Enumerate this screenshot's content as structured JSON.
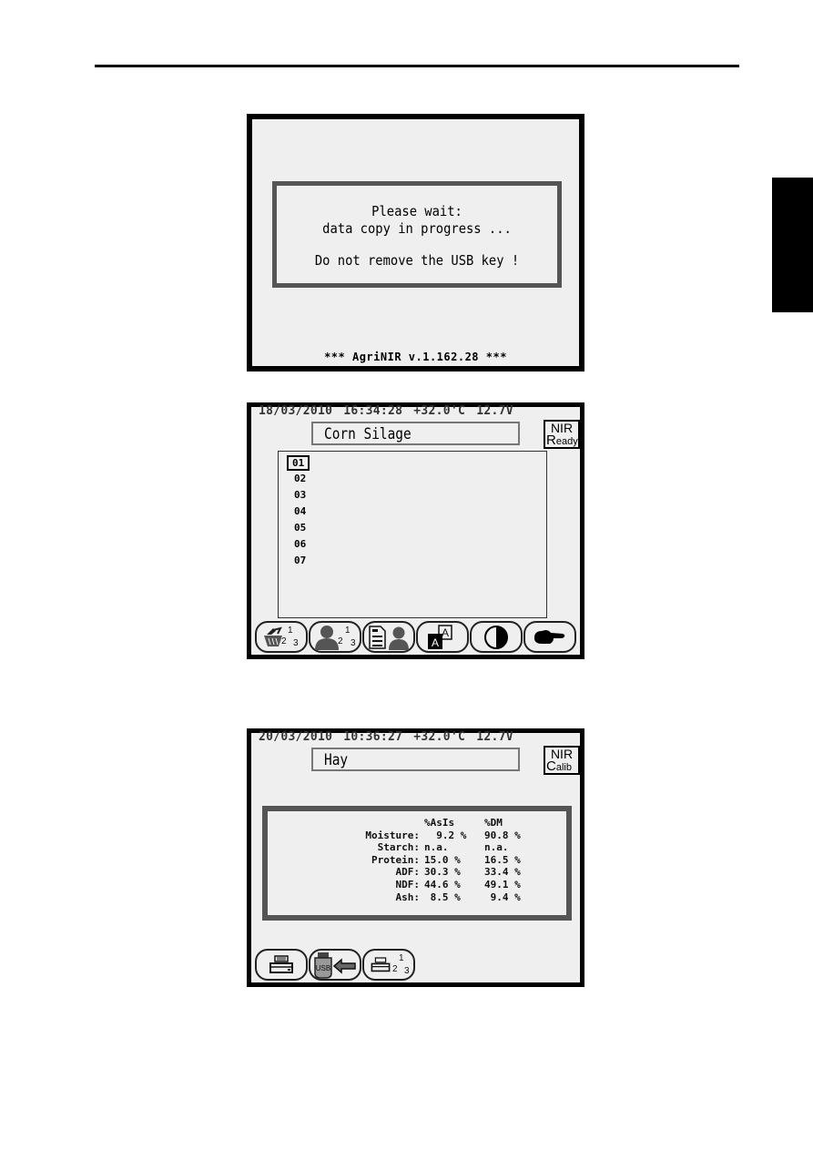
{
  "page": {
    "decorations": [
      "header-rule",
      "side-tab"
    ]
  },
  "screen1": {
    "dialog": {
      "line1": "Please wait:",
      "line2": "data copy in progress ...",
      "line3": "Do not remove the USB key !"
    },
    "footer": "*** AgriNIR v.1.162.28 ***"
  },
  "screen2": {
    "status": {
      "date": "18/03/2010",
      "time": "16:34:28",
      "temperature": "+32.0'C",
      "voltage": "12.7V"
    },
    "product_name": "Corn Silage",
    "nir_badge": {
      "top": "NIR",
      "bottom_initial": "R",
      "bottom_rest": "eady"
    },
    "samples": [
      "01",
      "02",
      "03",
      "04",
      "05",
      "06",
      "07"
    ],
    "selected_sample": "01",
    "toolbar": [
      {
        "icon": "analysis-repeat-icon",
        "numbers": "1 2 3"
      },
      {
        "icon": "operator-numbered-icon",
        "numbers": "1 2 3"
      },
      {
        "icon": "document-operator-icon"
      },
      {
        "icon": "font-size-icon",
        "glyph": "A"
      },
      {
        "icon": "contrast-icon"
      },
      {
        "icon": "pointing-hand-icon"
      }
    ]
  },
  "screen3": {
    "status": {
      "date": "20/03/2010",
      "time": "10:36:27",
      "temperature": "+32.0'C",
      "voltage": "12.7V"
    },
    "product_name": "Hay",
    "nir_badge": {
      "top": "NIR",
      "bottom_initial": "C",
      "bottom_rest": "alib"
    },
    "results": {
      "headers": {
        "label": "",
        "asis": "%AsIs",
        "dm": "%DM"
      },
      "rows": [
        {
          "label": "Moisture:",
          "asis": "  9.2 %",
          "dm": "90.8 %"
        },
        {
          "label": "Starch:",
          "asis": "n.a.",
          "dm": "n.a."
        },
        {
          "label": "Protein:",
          "asis": "15.0 %",
          "dm": "16.5 %"
        },
        {
          "label": "ADF:",
          "asis": "30.3 %",
          "dm": "33.4 %"
        },
        {
          "label": "NDF:",
          "asis": "44.6 %",
          "dm": "49.1 %"
        },
        {
          "label": "Ash:",
          "asis": " 8.5 %",
          "dm": " 9.4 %"
        }
      ]
    },
    "toolbar": [
      {
        "icon": "printer-icon"
      },
      {
        "icon": "usb-export-icon",
        "label": "USB"
      },
      {
        "icon": "printer-numbered-icon",
        "numbers": "1 2 3"
      }
    ]
  }
}
